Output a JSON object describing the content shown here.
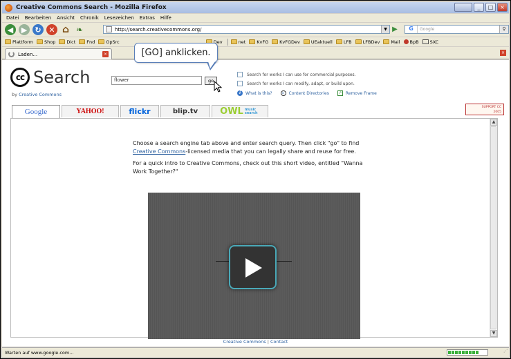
{
  "window": {
    "title": "Creative Commons Search - Mozilla Firefox",
    "minimize": "_",
    "maximize": "□",
    "close": "×"
  },
  "menu": [
    "Datei",
    "Bearbeiten",
    "Ansicht",
    "Chronik",
    "Lesezeichen",
    "Extras",
    "Hilfe"
  ],
  "nav": {
    "url": "http://search.creativecommons.org/",
    "search_placeholder": "Google"
  },
  "bookmarks": [
    "Plattform",
    "Shop",
    "Dict",
    "Fnd",
    "OpSrc",
    "Dev",
    "net",
    "KvFG",
    "KvFGDev",
    "UEaktuell",
    "LFB",
    "LFBDev",
    "Mail",
    "BpB",
    "SXC"
  ],
  "tab": {
    "label": "Laden..."
  },
  "callout": {
    "text": "[GO] anklicken."
  },
  "search": {
    "logo_cc": "cc",
    "logo_text": "Search",
    "by_prefix": "by",
    "by_link": "Creative Commons",
    "query": "flower",
    "go_label": "go",
    "opt_commercial": "Search for works I can use for commercial purposes.",
    "opt_modify": "Search for works I can modify, adapt, or build upon.",
    "what_is_this": "What is this?",
    "content_directories": "Content Directories",
    "remove_frame": "Remove Frame",
    "support_line1": "SUPPORT CC",
    "support_line2": "2005"
  },
  "engines": {
    "google": "Google",
    "yahoo": "YAHOO!",
    "flickr": "flickr",
    "bliptv": "blip.tv",
    "owl": "OWL",
    "owl_sub": "music search"
  },
  "intro": {
    "p1_before": "Choose a search engine tab above and enter search query. Then click \"go\" to find ",
    "p1_link": "Creative Commons",
    "p1_after": "-licensed media that you can legally share and reuse for free.",
    "p2": "For a quick intro to Creative Commons, check out this short video, entitled \"Wanna Work Together?\""
  },
  "footer": {
    "link1": "Creative Commons",
    "separator": "|",
    "link2": "Contact"
  },
  "status": {
    "text": "Warten auf www.google.com...",
    "progress_fraction": 0.85
  }
}
